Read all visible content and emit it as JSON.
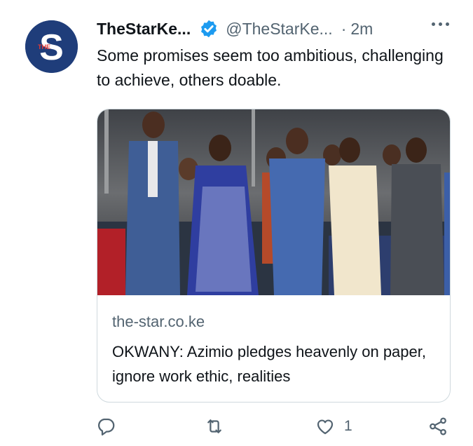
{
  "tweet": {
    "display_name": "TheStarKe...",
    "handle": "@TheStarKe...",
    "separator": "·",
    "time": "2m",
    "text": "Some promises seem too ambitious, challenging to achieve, others doable.",
    "avatar_letter": "S",
    "avatar_small_text": "THE"
  },
  "card": {
    "domain": "the-star.co.ke",
    "title": "OKWANY: Azimio pledges heavenly on paper, ignore work ethic, realities"
  },
  "actions": {
    "reply_count": "",
    "retweet_count": "",
    "like_count": "1"
  },
  "colors": {
    "brand": "#1f3d7a",
    "verified": "#1d9bf0",
    "secondary_text": "#536471",
    "border": "#cfd9de"
  },
  "icons": [
    "verified-badge-icon",
    "more-icon",
    "reply-icon",
    "retweet-icon",
    "like-icon",
    "share-icon"
  ]
}
